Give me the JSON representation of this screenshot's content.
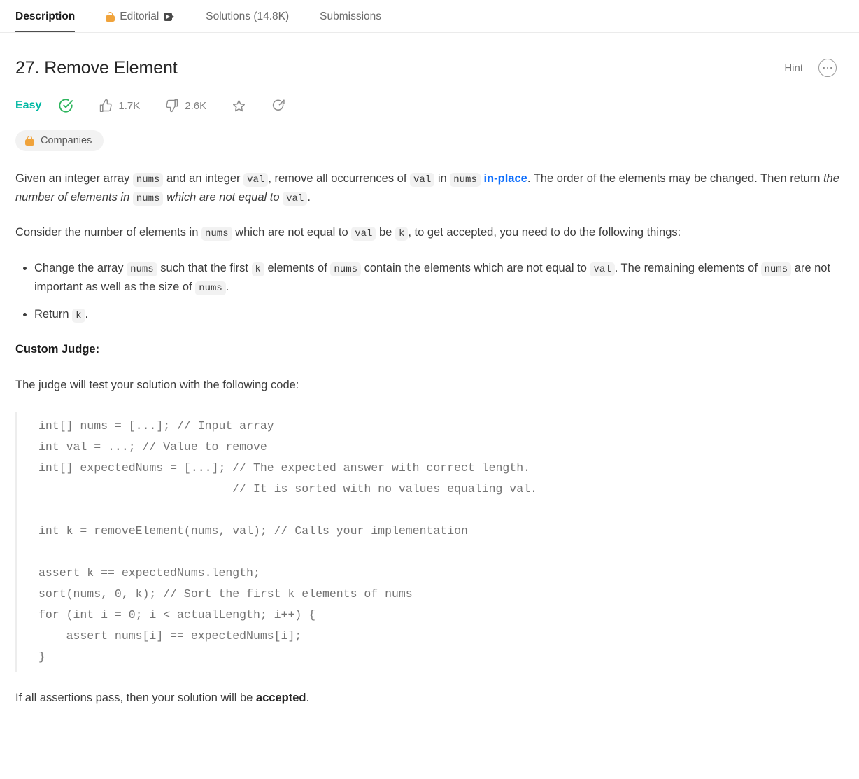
{
  "tabs": [
    {
      "label": "Description",
      "icon": null,
      "trailing_icon": null,
      "active": true
    },
    {
      "label": "Editorial",
      "icon": "lock-icon",
      "trailing_icon": "video-icon",
      "active": false
    },
    {
      "label": "Solutions (14.8K)",
      "icon": null,
      "trailing_icon": null,
      "active": false
    },
    {
      "label": "Submissions",
      "icon": null,
      "trailing_icon": null,
      "active": false
    }
  ],
  "header": {
    "title": "27. Remove Element",
    "hint_label": "Hint",
    "more_icon": "ellipsis-circle-icon"
  },
  "meta": {
    "difficulty": "Easy",
    "difficulty_color": "#00b8a3",
    "solved_icon": "check-circle-icon",
    "solved_color": "#2db55d",
    "upvotes": "1.7K",
    "downvotes": "2.6K",
    "upvote_icon": "thumbs-up-icon",
    "downvote_icon": "thumbs-down-icon",
    "favorite_icon": "star-icon",
    "share_icon": "share-icon"
  },
  "companies": {
    "label": "Companies",
    "icon": "lock-icon",
    "lock_color": "#f0a33b"
  },
  "description": {
    "para1": {
      "t1": "Given an integer array ",
      "c1": "nums",
      "t2": " and an integer ",
      "c2": "val",
      "t3": ", remove all occurrences of ",
      "c3": "val",
      "t4": " in ",
      "c4": "nums",
      "link": "in-place",
      "t5": ". The order of the elements may be changed. Then return ",
      "em1": "the number of elements in",
      "c5": "nums",
      "em2": "which are not equal to",
      "c6": "val",
      "t6": "."
    },
    "para2": {
      "t1": "Consider the number of elements in ",
      "c1": "nums",
      "t2": " which are not equal to ",
      "c2": "val",
      "t3": " be ",
      "c3": "k",
      "t4": ", to get accepted, you need to do the following things:"
    },
    "bullets": [
      {
        "t1": "Change the array ",
        "c1": "nums",
        "t2": " such that the first ",
        "c2": "k",
        "t3": " elements of ",
        "c3": "nums",
        "t4": " contain the elements which are not equal to ",
        "c4": "val",
        "t5": ". The remaining elements of ",
        "c5": "nums",
        "t6": " are not important as well as the size of ",
        "c6": "nums",
        "t7": "."
      },
      {
        "t1": "Return ",
        "c1": "k",
        "t2": "."
      }
    ],
    "custom_judge_heading": "Custom Judge:",
    "judge_intro": "The judge will test your solution with the following code:",
    "code": "int[] nums = [...]; // Input array\nint val = ...; // Value to remove\nint[] expectedNums = [...]; // The expected answer with correct length.\n                            // It is sorted with no values equaling val.\n\nint k = removeElement(nums, val); // Calls your implementation\n\nassert k == expectedNums.length;\nsort(nums, 0, k); // Sort the first k elements of nums\nfor (int i = 0; i < actualLength; i++) {\n    assert nums[i] == expectedNums[i];\n}",
    "closing": {
      "t1": "If all assertions pass, then your solution will be ",
      "strong": "accepted",
      "t2": "."
    }
  }
}
